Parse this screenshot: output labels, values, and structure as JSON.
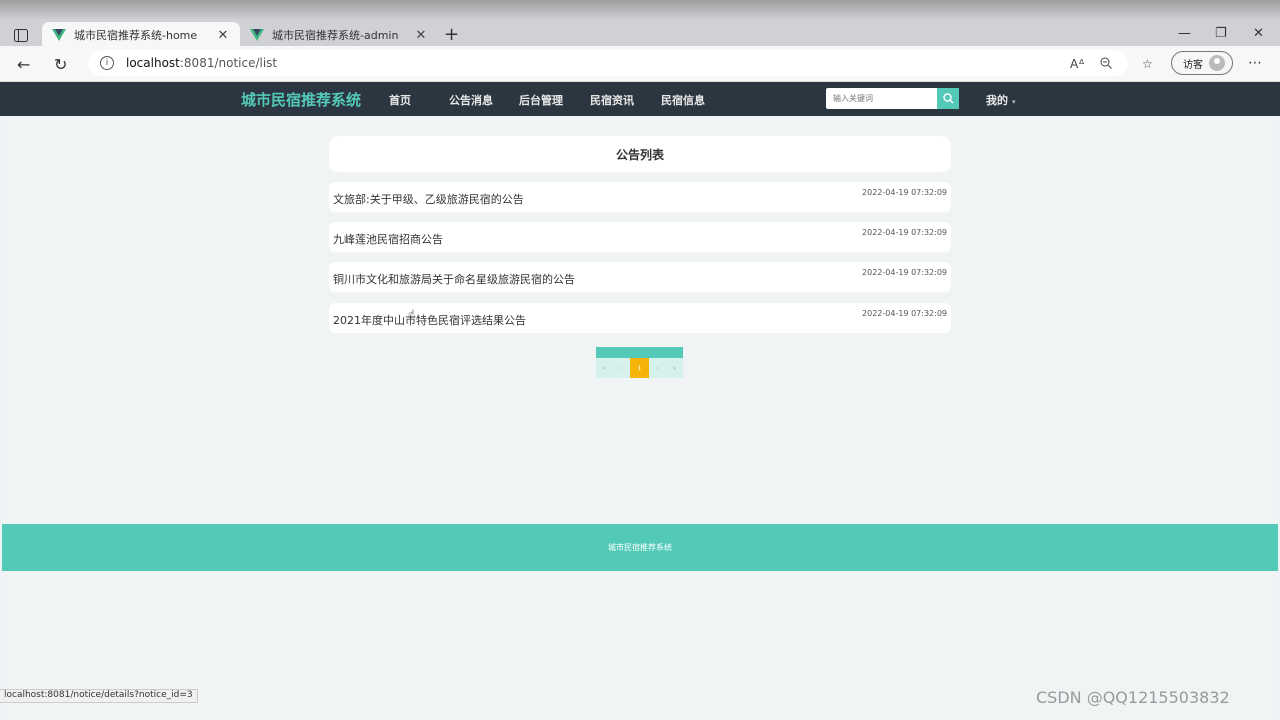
{
  "browser": {
    "tabs": [
      {
        "title": "城市民宿推荐系统-home",
        "active": true
      },
      {
        "title": "城市民宿推荐系统-admin",
        "active": false
      }
    ],
    "url_host": "localhost",
    "url_rest": ":8081/notice/list",
    "profile_label": "访客",
    "status_url": "localhost:8081/notice/details?notice_id=3"
  },
  "site": {
    "brand": "城市民宿推荐系统",
    "nav": [
      "首页",
      "公告消息",
      "后台管理",
      "民宿资讯",
      "民宿信息"
    ],
    "search_placeholder": "输入关键词",
    "mine": "我的"
  },
  "notices": {
    "heading": "公告列表",
    "items": [
      {
        "title": "文旅部:关于甲级、乙级旅游民宿的公告",
        "date": "2022-04-19 07:32:09"
      },
      {
        "title": "九峰莲池民宿招商公告",
        "date": "2022-04-19 07:32:09"
      },
      {
        "title": "铜川市文化和旅游局关于命名星级旅游民宿的公告",
        "date": "2022-04-19 07:32:09"
      },
      {
        "title": "2021年度中山市特色民宿评选结果公告",
        "date": "2022-04-19 07:32:09"
      }
    ]
  },
  "pagination": {
    "first": "«",
    "prev": "‹",
    "current": "1",
    "next": "›",
    "last": "»"
  },
  "footer": {
    "text": "城市民宿推荐系统"
  },
  "watermark": "CSDN @QQ1215503832",
  "colors": {
    "accent": "#53cab8",
    "header_bg": "#2c3640",
    "current_page": "#f5b40a"
  }
}
